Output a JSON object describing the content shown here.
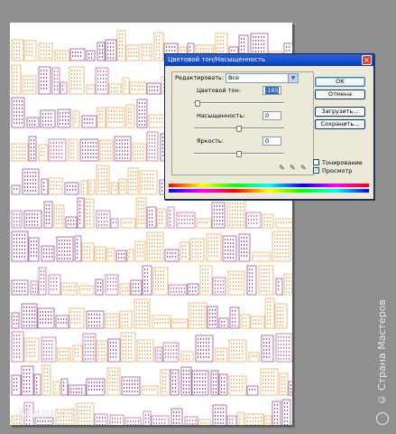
{
  "dialog": {
    "title": "Цветовой тон/Насыщенность",
    "edit_label": "Редактировать:",
    "edit_value": "Все",
    "hue_label": "Цветовой тон:",
    "hue_value": "-165",
    "hue_level": 0.04,
    "saturation_label": "Насыщенность:",
    "saturation_value": "0",
    "saturation_level": 0.5,
    "lightness_label": "Яркость:",
    "lightness_value": "0",
    "lightness_level": 0.5,
    "ok_label": "ОК",
    "cancel_label": "Отмена",
    "load_label": "Загрузить...",
    "save_label": "Сохранить...",
    "colorize_label": "Тонирование",
    "colorize_checked": false,
    "preview_label": "Просмотр",
    "preview_checked": true
  },
  "signature": "Мария74",
  "watermark": "© Страна Мастеров",
  "colors": {
    "pattern_orange": "#f4a95e",
    "pattern_purple": "#a0509a",
    "pattern_pink": "#c96aa8",
    "canvas_bg": "#8f8f8f",
    "dialog_bg": "#ece9d8",
    "titlebar": "#0a3db8"
  }
}
